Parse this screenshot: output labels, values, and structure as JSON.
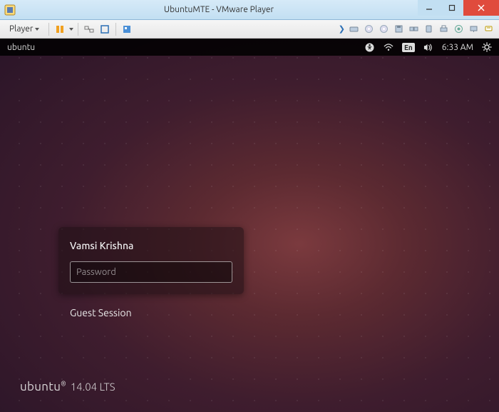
{
  "window": {
    "title": "UbuntuMTE - VMware Player",
    "controls": {
      "minimize": "–",
      "maximize": "❐",
      "close": "✕"
    }
  },
  "vmtoolbar": {
    "player_label": "Player"
  },
  "panel": {
    "hostname": "ubuntu",
    "lang_badge": "En",
    "clock": "6:33 AM"
  },
  "login": {
    "username": "Vamsi Krishna",
    "password_placeholder": "Password",
    "guest_label": "Guest Session"
  },
  "brand": {
    "name": "ubuntu",
    "reg": "®",
    "version": "14.04 LTS"
  }
}
